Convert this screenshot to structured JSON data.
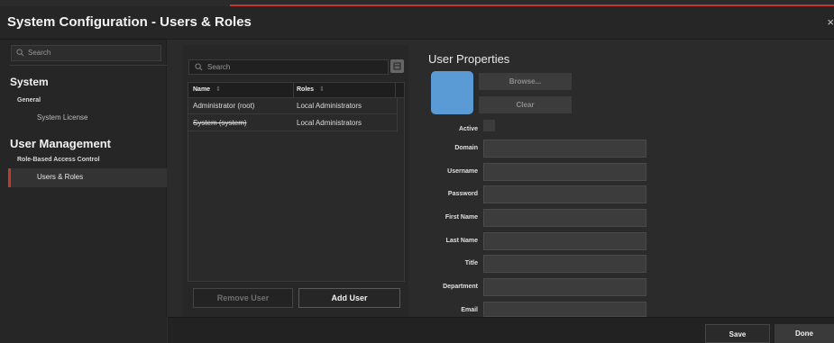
{
  "window": {
    "title": "System Configuration - Users & Roles",
    "close_glyph": "×"
  },
  "sidebar": {
    "search_placeholder": "Search",
    "sections": [
      {
        "title": "System",
        "groups": [
          {
            "title": "General",
            "items": [
              "System License"
            ]
          }
        ]
      },
      {
        "title": "User Management",
        "groups": [
          {
            "title": "Role-Based Access Control",
            "items": [
              "Users & Roles"
            ]
          }
        ]
      }
    ],
    "active_item": "Users & Roles"
  },
  "users_grid": {
    "search_placeholder": "Search",
    "columns": [
      "Name",
      "Roles"
    ],
    "sort_glyph": "⇕",
    "rows": [
      {
        "name": "Administrator (root)",
        "roles": "Local Administrators",
        "disabled": false
      },
      {
        "name": "System (system)",
        "roles": "Local Administrators",
        "disabled": true
      }
    ],
    "remove_label": "Remove User",
    "add_label": "Add User"
  },
  "user_properties": {
    "title": "User Properties",
    "browse_label": "Browse...",
    "clear_label": "Clear",
    "avatar_color": "#5b9bd5",
    "active_label": "Active",
    "fields": [
      "Domain",
      "Username",
      "Password",
      "First Name",
      "Last Name",
      "Title",
      "Department",
      "Email"
    ]
  },
  "footer": {
    "save_label": "Save",
    "done_label": "Done"
  },
  "colors": {
    "accent": "#c0392b",
    "background": "#2b2b2b"
  }
}
